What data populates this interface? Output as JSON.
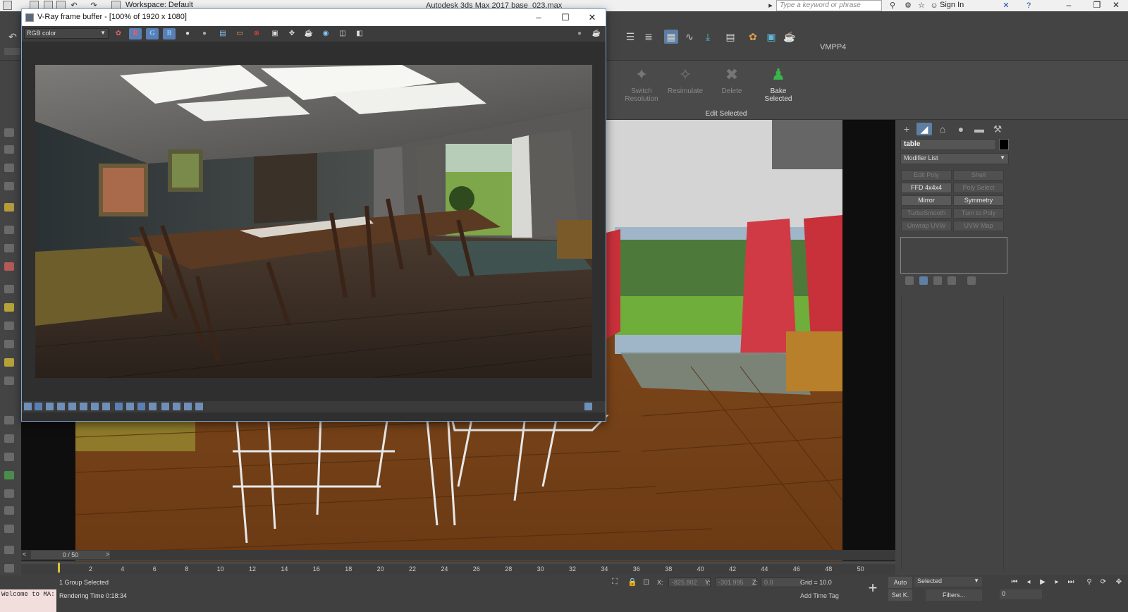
{
  "app": {
    "title": "Autodesk 3ds Max 2017    base_023.max",
    "workspace": "Workspace: Default",
    "search_placeholder": "Type a keyword or phrase",
    "signin": "Sign In"
  },
  "toolbar": {
    "vmpp": "VMPP4"
  },
  "ribbon": {
    "buttons": [
      {
        "label": "Switch\nResolution"
      },
      {
        "label": "Resimulate"
      },
      {
        "label": "Delete"
      },
      {
        "label": "Bake\nSelected"
      }
    ],
    "group_label": "Edit Selected"
  },
  "vfb": {
    "title": "V-Ray frame buffer - [100% of 1920 x 1080]",
    "channel": "RGB color",
    "r": "R",
    "g": "G",
    "b": "B"
  },
  "command_panel": {
    "object_name": "table",
    "modifier_list": "Modifier List",
    "modifiers": [
      {
        "label": "Edit Poly",
        "enabled": false
      },
      {
        "label": "Shell",
        "enabled": false
      },
      {
        "label": "FFD 4x4x4",
        "enabled": true
      },
      {
        "label": "Poly Select",
        "enabled": false
      },
      {
        "label": "Mirror",
        "enabled": true
      },
      {
        "label": "Symmetry",
        "enabled": true
      },
      {
        "label": "TurboSmooth",
        "enabled": false
      },
      {
        "label": "Turn to Poly",
        "enabled": false
      },
      {
        "label": "Unwrap UVW",
        "enabled": false
      },
      {
        "label": "UVW Map",
        "enabled": false
      }
    ]
  },
  "timeline": {
    "frame_counter": "0 / 50",
    "ticks": [
      "2",
      "4",
      "6",
      "8",
      "10",
      "12",
      "14",
      "16",
      "18",
      "20",
      "22",
      "24",
      "26",
      "28",
      "30",
      "32",
      "34",
      "36",
      "38",
      "40",
      "42",
      "44",
      "46",
      "48",
      "50"
    ]
  },
  "status": {
    "maxscript": "Welcome to MA:",
    "selection": "1 Group Selected",
    "render_time": "Rendering Time  0:18:34",
    "x_label": "X:",
    "x_value": "-825.802",
    "y_label": "Y:",
    "y_value": "-301.995",
    "z_label": "Z:",
    "z_value": "0.0",
    "grid": "Grid = 10.0",
    "add_time_tag": "Add Time Tag",
    "auto": "Auto",
    "set_key": "Set K.",
    "key_filter": "Selected",
    "filters": "Filters...",
    "frame": "0"
  },
  "colors": {
    "accent": "#5e7fa3",
    "bake_green": "#39b54a"
  }
}
